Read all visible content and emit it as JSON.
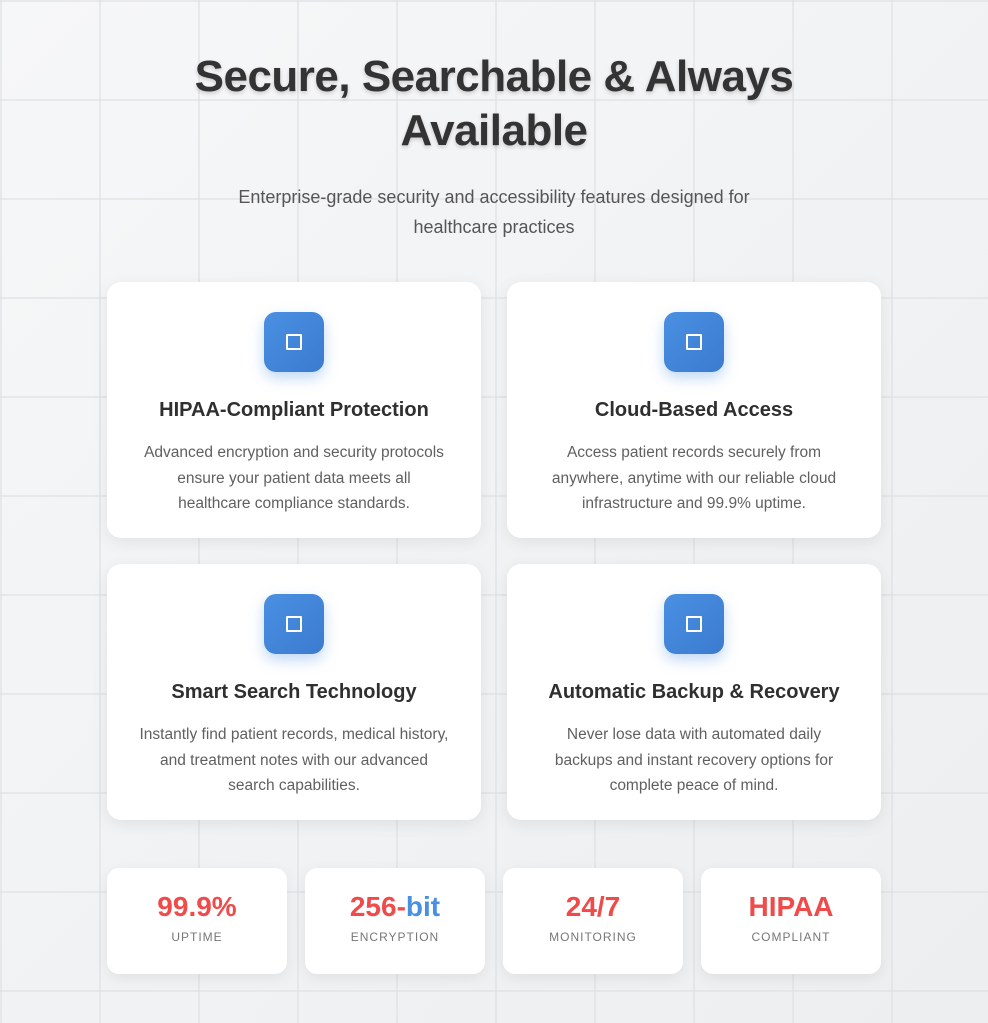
{
  "header": {
    "title": "Secure, Searchable & Always Available",
    "subtitle": "Enterprise-grade security and accessibility features designed for healthcare practices"
  },
  "features": [
    {
      "icon": "square-icon",
      "title": "HIPAA-Compliant Protection",
      "description": "Advanced encryption and security protocols ensure your patient data meets all healthcare compliance standards."
    },
    {
      "icon": "square-icon",
      "title": "Cloud-Based Access",
      "description": "Access patient records securely from anywhere, anytime with our reliable cloud infrastructure and 99.9% uptime."
    },
    {
      "icon": "square-icon",
      "title": "Smart Search Technology",
      "description": "Instantly find patient records, medical history, and treatment notes with our advanced search capabilities."
    },
    {
      "icon": "square-icon",
      "title": "Automatic Backup & Recovery",
      "description": "Never lose data with automated daily backups and instant recovery options for complete peace of mind."
    }
  ],
  "stats": [
    {
      "value": "99.9%",
      "value_accent": "",
      "label": "UPTIME"
    },
    {
      "value": "256-",
      "value_accent": "bit",
      "label": "ENCRYPTION"
    },
    {
      "value": "24/7",
      "value_accent": "",
      "label": "MONITORING"
    },
    {
      "value": "HIPAA",
      "value_accent": "",
      "label": "COMPLIANT"
    }
  ],
  "colors": {
    "accent_blue": "#4a90e2",
    "stat_red": "#ef4b4b",
    "background": "#f1f2f4"
  }
}
